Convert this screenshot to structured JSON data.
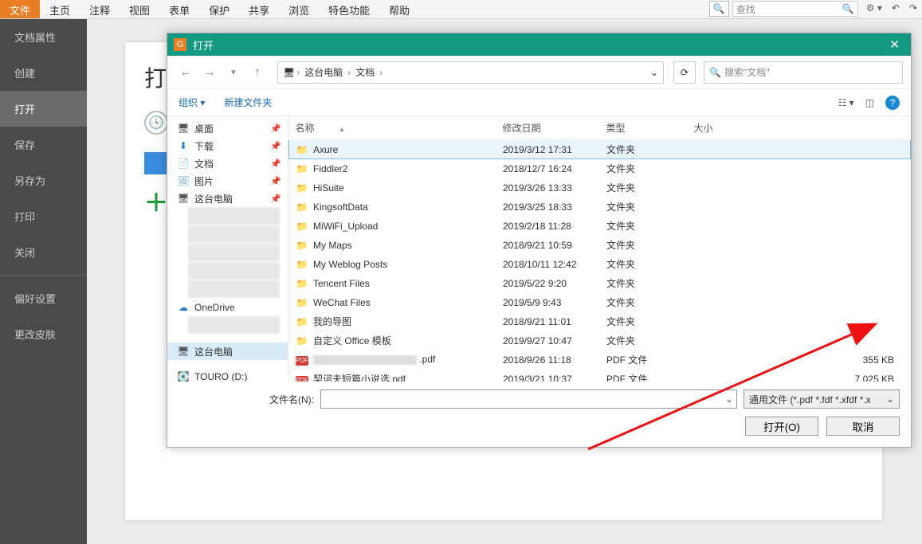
{
  "ribbon": {
    "tabs": [
      "文件",
      "主页",
      "注释",
      "视图",
      "表单",
      "保护",
      "共享",
      "浏览",
      "特色功能",
      "帮助"
    ],
    "active": 0,
    "search_placeholder": "查找"
  },
  "sidebar": {
    "items": [
      "文档属性",
      "创建",
      "打开",
      "保存",
      "另存为",
      "打印",
      "关闭",
      "偏好设置",
      "更改皮肤"
    ],
    "active": 2
  },
  "page": {
    "title": "打开"
  },
  "dialog": {
    "title": "打开",
    "breadcrumb": [
      "这台电脑",
      "文档"
    ],
    "search_placeholder": "搜索\"文档\"",
    "toolbar": {
      "organize": "组织",
      "newfolder": "新建文件夹"
    },
    "tree": [
      {
        "icon": "🖥",
        "label": "桌面",
        "pin": true
      },
      {
        "icon": "⬇",
        "label": "下载",
        "pin": true,
        "iconColor": "#2a7ad4"
      },
      {
        "icon": "📄",
        "label": "文档",
        "pin": true,
        "iconColor": "#69a8d8"
      },
      {
        "icon": "🖼",
        "label": "图片",
        "pin": true,
        "iconColor": "#69a8d8"
      },
      {
        "icon": "🖥",
        "label": "这台电脑",
        "pin": true,
        "iconColor": "#5b5b5b"
      },
      {
        "blur": true
      },
      {
        "blur": true
      },
      {
        "blur": true
      },
      {
        "blur": true
      },
      {
        "blur": true
      },
      {
        "icon": "☁",
        "label": "OneDrive",
        "iconColor": "#2a7ad4"
      },
      {
        "blur": true
      },
      {
        "spacer": true
      },
      {
        "icon": "🖥",
        "label": "这台电脑",
        "sel": true,
        "iconColor": "#5b5b5b"
      },
      {
        "spacer": true
      },
      {
        "icon": "💽",
        "label": "TOURO (D:)"
      }
    ],
    "columns": {
      "name": "名称",
      "date": "修改日期",
      "type": "类型",
      "size": "大小"
    },
    "files": [
      {
        "name": "Axure",
        "date": "2019/3/12 17:31",
        "type": "文件夹",
        "size": "",
        "kind": "folder",
        "sel": true
      },
      {
        "name": "Fiddler2",
        "date": "2018/12/7 16:24",
        "type": "文件夹",
        "size": "",
        "kind": "folder"
      },
      {
        "name": "HiSuite",
        "date": "2019/3/26 13:33",
        "type": "文件夹",
        "size": "",
        "kind": "folder"
      },
      {
        "name": "KingsoftData",
        "date": "2019/3/25 18:33",
        "type": "文件夹",
        "size": "",
        "kind": "folder"
      },
      {
        "name": "MiWiFi_Upload",
        "date": "2019/2/18 11:28",
        "type": "文件夹",
        "size": "",
        "kind": "folder"
      },
      {
        "name": "My Maps",
        "date": "2018/9/21 10:59",
        "type": "文件夹",
        "size": "",
        "kind": "folder"
      },
      {
        "name": "My Weblog Posts",
        "date": "2018/10/11 12:42",
        "type": "文件夹",
        "size": "",
        "kind": "folder"
      },
      {
        "name": "Tencent Files",
        "date": "2019/5/22 9:20",
        "type": "文件夹",
        "size": "",
        "kind": "folder"
      },
      {
        "name": "WeChat Files",
        "date": "2019/5/9 9:43",
        "type": "文件夹",
        "size": "",
        "kind": "folder"
      },
      {
        "name": "我的导图",
        "date": "2018/9/21 11:01",
        "type": "文件夹",
        "size": "",
        "kind": "folder"
      },
      {
        "name": "自定义 Office 模板",
        "date": "2019/9/27 10:47",
        "type": "文件夹",
        "size": "",
        "kind": "folder"
      },
      {
        "name": ".pdf",
        "date": "2018/9/26 11:18",
        "type": "PDF 文件",
        "size": "355 KB",
        "kind": "pdf",
        "blur": true
      },
      {
        "name": "契诃夫短篇小说选.pdf",
        "date": "2019/3/21 10:37",
        "type": "PDF 文件",
        "size": "7,025 KB",
        "kind": "pdf"
      }
    ],
    "filename_label": "文件名(N):",
    "filetype": "通用文件 (*.pdf *.fdf *.xfdf *.x",
    "open_btn": "打开(O)",
    "cancel_btn": "取消"
  }
}
